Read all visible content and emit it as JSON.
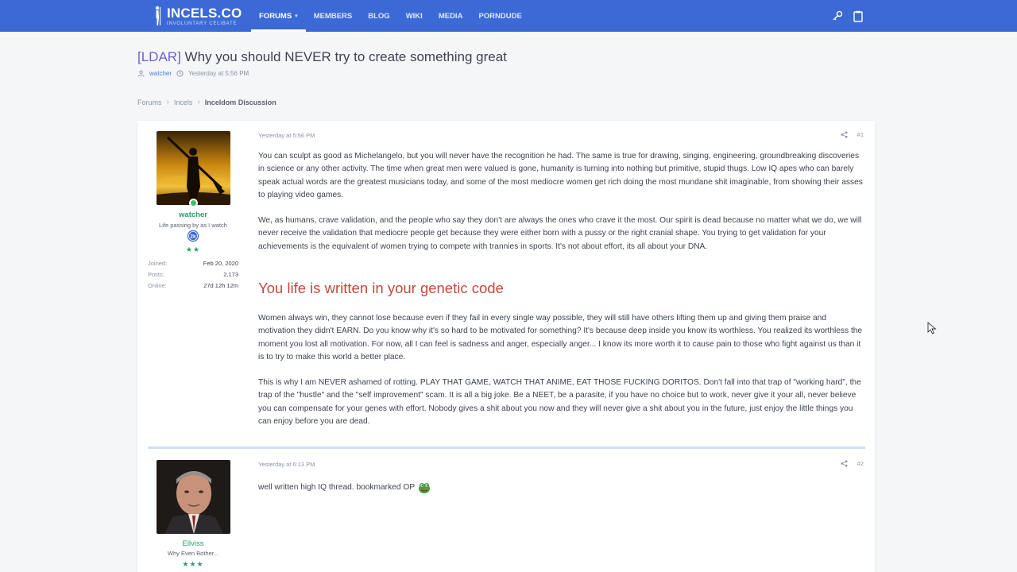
{
  "site": {
    "logo_main": "INCELS.CO",
    "logo_sub": "INVOLUNTARY CELIBATE"
  },
  "nav": {
    "items": [
      {
        "label": "FORUMS"
      },
      {
        "label": "MEMBERS"
      },
      {
        "label": "BLOG"
      },
      {
        "label": "WIKI"
      },
      {
        "label": "MEDIA"
      },
      {
        "label": "PORNDUDE"
      }
    ],
    "active": "FORUMS"
  },
  "top_icons": [
    "key-icon",
    "clipboard-icon"
  ],
  "thread": {
    "prefix": "[LDAR]",
    "title": "Why you should NEVER try to create something great",
    "author": "watcher",
    "date": "Yesterday at 5:56 PM"
  },
  "breadcrumb": [
    "Forums",
    "Incels",
    "Inceldom Discussion"
  ],
  "posts": [
    {
      "date": "Yesterday at 5:56 PM",
      "number": "#1",
      "user": {
        "name": "watcher",
        "title": "Life passing by as I watch",
        "stars": "★★",
        "stats": [
          {
            "key": "Joined:",
            "value": "Feb 20, 2020"
          },
          {
            "key": "Posts:",
            "value": "2,173"
          },
          {
            "key": "Online:",
            "value": "27d 12h 12m"
          }
        ]
      },
      "paragraphs": [
        "You can sculpt as good as Michelangelo, but you will never have the recognition he had. The same is true for drawing, singing, engineering, groundbreaking discoveries in science or any other activity. The time when great men were valued is gone, humanity is turning into nothing but primitive, stupid thugs. Low IQ apes who can barely speak actual words are the greatest musicians today, and some of the most mediocre women get rich doing the most mundane shit imaginable, from showing their asses to playing video games.",
        "We, as humans, crave validation, and the people who say they don't are always the ones who crave it the most. Our spirit is dead because no matter what we do, we will never receive the validation that mediocre people get because they were either born with a pussy or the right cranial shape. You trying to get validation for your achievements is the equivalent of women trying to compete with trannies in sports. It's not about effort, its all about your DNA."
      ],
      "heading": "You life is written in your genetic code",
      "paragraphs_after": [
        "Women always win, they cannot lose because even if they fail in every single way possible, they will still have others lifting them up and giving them praise and motivation they didn't EARN. Do you know why it's so hard to be motivated for something? It's because deep inside you know its worthless. You realized its worthless the moment you lost all motivation. For now, all I can feel is sadness and anger, especially anger... I know its more worth it to cause pain to those who fight against us than it is to try to make this world a better place.",
        "This is why I am NEVER ashamed of rotting. PLAY THAT GAME, WATCH THAT ANIME, EAT THOSE FUCKING DORITOS. Don't fall into that trap of \"working hard\", the trap of the \"hustle\" and the \"self improvement\" scam. It is all a big joke. Be a NEET, be a parasite, if you have no choice but to work, never give it your all, never believe you can compensate for your genes with effort. Nobody gives a shit about you now and they will never give a shit about you in the future, just enjoy the little things you can enjoy before you are dead."
      ]
    },
    {
      "date": "Yesterday at 6:13 PM",
      "number": "#2",
      "user": {
        "name": "Ellviss",
        "title": "Why Even Bother...",
        "stars": "★★★"
      },
      "text": "well written high IQ thread. bookmarked OP"
    }
  ],
  "colors": {
    "topbar": "#3b6ad6",
    "username": "#2e9c6b",
    "heading": "#c24a3e",
    "prefix": "#6d5fc7"
  }
}
